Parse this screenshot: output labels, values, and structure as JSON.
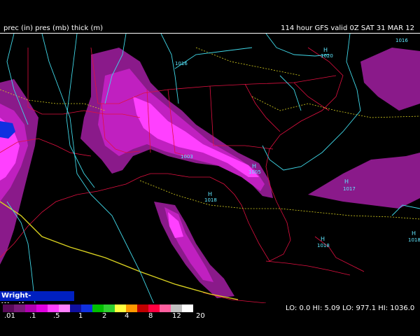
{
  "header": {
    "left_title": "prec (in) pres (mb) thick (m)",
    "right_title": "114 hour GFS valid 0Z SAT 31 MAR 12"
  },
  "branding": "Wright-Weather.com",
  "legend": {
    "scale_labels": [
      ".01",
      ".1",
      ".5",
      "1",
      "2",
      "4",
      "8",
      "12",
      "20"
    ],
    "colors": [
      "#5a0a5a",
      "#7a1a7a",
      "#b000b0",
      "#e000e0",
      "#ff40ff",
      "#ff80ff",
      "#1010a0",
      "#1030e0",
      "#00c000",
      "#30d030",
      "#ffff40",
      "#ff9900",
      "#c00000",
      "#ff0040",
      "#ff60a0",
      "#c0c0c0",
      "#ffffff"
    ],
    "stats": "LO:  0.0  HI:  5.09  LO: 977.1  HI: 1036.0"
  },
  "pressure_labels": {
    "l1016_ne": "1016",
    "l1016_nc": "1016",
    "h1020": "H",
    "v1020": "1020",
    "h_ga": "H",
    "v_ga": "1005",
    "h_gulf": "H",
    "v_gulf": "1018",
    "h_atl": "H",
    "v_atl": "1017",
    "h_bah": "H",
    "v_bah": "1018",
    "h_east": "1016",
    "h_tx": "H",
    "v_tx": "1018",
    "la_val": "1003"
  },
  "map_colors": {
    "background": "#000000",
    "precip_dark": "#8a1a8a",
    "precip_mid": "#c020c0",
    "precip_light": "#ff40ff",
    "isobar": "#40d8e8",
    "thickness": "#d8d020",
    "borders": "#e01040"
  }
}
